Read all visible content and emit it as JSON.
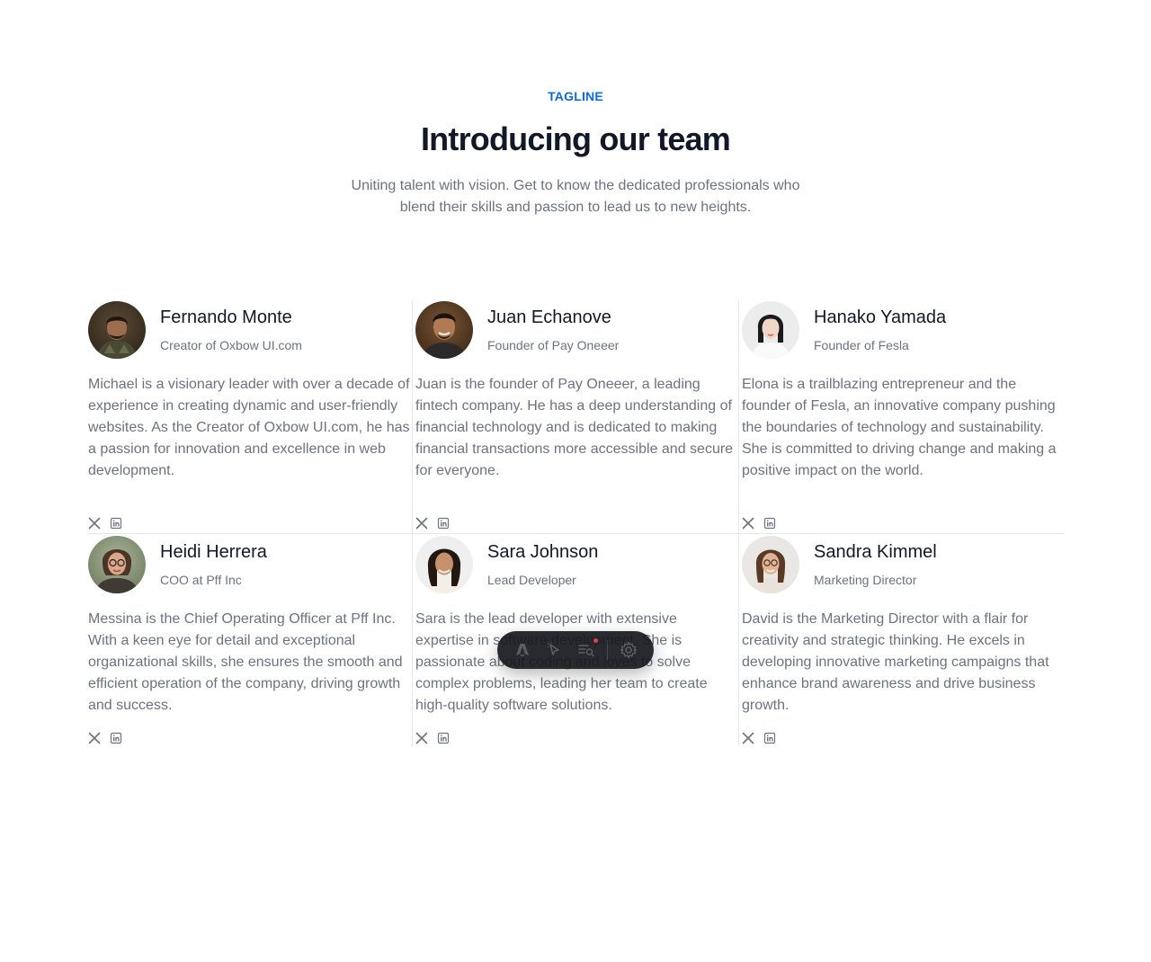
{
  "header": {
    "tagline": "TAGLINE",
    "title": "Introducing our team",
    "subtitle": "Uniting talent with vision. Get to know the dedicated professionals who blend their skills and passion to lead us to new heights."
  },
  "team": [
    {
      "name": "Fernando Monte",
      "role": "Creator of Oxbow UI.com",
      "bio": "Michael is a visionary leader with over a decade of experience in creating dynamic and user-friendly websites. As the Creator of Oxbow UI.com, he has a passion for innovation and excellence in web development.",
      "socials": [
        "x-icon",
        "linkedin-icon"
      ]
    },
    {
      "name": "Juan Echanove",
      "role": "Founder of Pay Oneeer",
      "bio": "Juan is the founder of Pay Oneeer, a leading fintech company. He has a deep understanding of financial technology and is dedicated to making financial transactions more accessible and secure for everyone.",
      "socials": [
        "x-icon",
        "linkedin-icon"
      ]
    },
    {
      "name": "Hanako Yamada",
      "role": "Founder of Fesla",
      "bio": "Elona is a trailblazing entrepreneur and the founder of Fesla, an innovative company pushing the boundaries of technology and sustainability. She is committed to driving change and making a positive impact on the world.",
      "socials": [
        "x-icon",
        "linkedin-icon"
      ]
    },
    {
      "name": "Heidi Herrera",
      "role": "COO at Pff Inc",
      "bio": "Messina is the Chief Operating Officer at Pff Inc. With a keen eye for detail and exceptional organizational skills, she ensures the smooth and efficient operation of the company, driving growth and success.",
      "socials": [
        "x-icon",
        "linkedin-icon"
      ]
    },
    {
      "name": "Sara Johnson",
      "role": "Lead Developer",
      "bio": "Sara is the lead developer with extensive expertise in software development. She is passionate about coding and loves to solve complex problems, leading her team to create high-quality software solutions.",
      "socials": [
        "x-icon",
        "linkedin-icon"
      ]
    },
    {
      "name": "Sandra Kimmel",
      "role": "Marketing Director",
      "bio": "David is the Marketing Director with a flair for creativity and strategic thinking. He excels in developing innovative marketing campaigns that enhance brand awareness and drive business growth.",
      "socials": [
        "x-icon",
        "linkedin-icon"
      ]
    }
  ],
  "toolbar": {
    "items": [
      "astro-logo-icon",
      "inspect-cursor-icon",
      "audit-icon",
      "settings-gear-icon"
    ]
  },
  "colors": {
    "accent": "#0b6bdf",
    "heading": "#111827",
    "muted": "#6b7280",
    "divider": "#e5e7eb"
  }
}
